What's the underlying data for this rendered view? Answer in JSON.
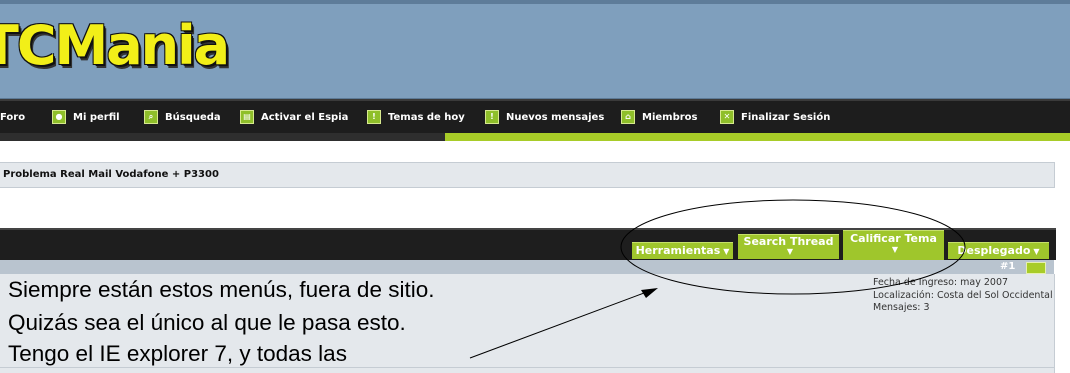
{
  "site": {
    "logo_text": "TCMania"
  },
  "nav": {
    "items": [
      {
        "label": "Foro",
        "icon": "forum-icon"
      },
      {
        "label": "Mi perfil",
        "icon": "profile-icon"
      },
      {
        "label": "Búsqueda",
        "icon": "search-icon"
      },
      {
        "label": "Activar el Espia",
        "icon": "spy-icon"
      },
      {
        "label": "Temas de hoy",
        "icon": "today-topics-icon"
      },
      {
        "label": "Nuevos mensajes",
        "icon": "new-messages-icon"
      },
      {
        "label": "Miembros",
        "icon": "members-icon"
      },
      {
        "label": "Finalizar Sesión",
        "icon": "logout-icon"
      }
    ]
  },
  "thread": {
    "title": "Problema Real Mail Vodafone + P3300"
  },
  "toolbar": {
    "herramientas": "Herramientas",
    "search_thread": "Search Thread",
    "calificar_tema": "Calificar Tema",
    "desplegado": "Desplegado"
  },
  "post": {
    "number": "#1",
    "user_info": {
      "fecha_ingreso": "Fecha de Ingreso: may 2007",
      "localizacion": "Localización: Costa del Sol Occidental",
      "mensajes": "Mensajes: 3"
    }
  },
  "annotation": {
    "lines": [
      "Siempre están estos menús, fuera de sitio.",
      "Quizás sea el único al que le pasa esto.",
      "Tengo el IE explorer 7, y todas las"
    ]
  },
  "colors": {
    "header_bg": "#7f9fbd",
    "logo_yellow": "#f2ef18",
    "nav_bg": "#1d1d1d",
    "accent_green": "#a8cc28",
    "panel_bg": "#e4e8ec",
    "post_header_bg": "#b9c4cf"
  }
}
